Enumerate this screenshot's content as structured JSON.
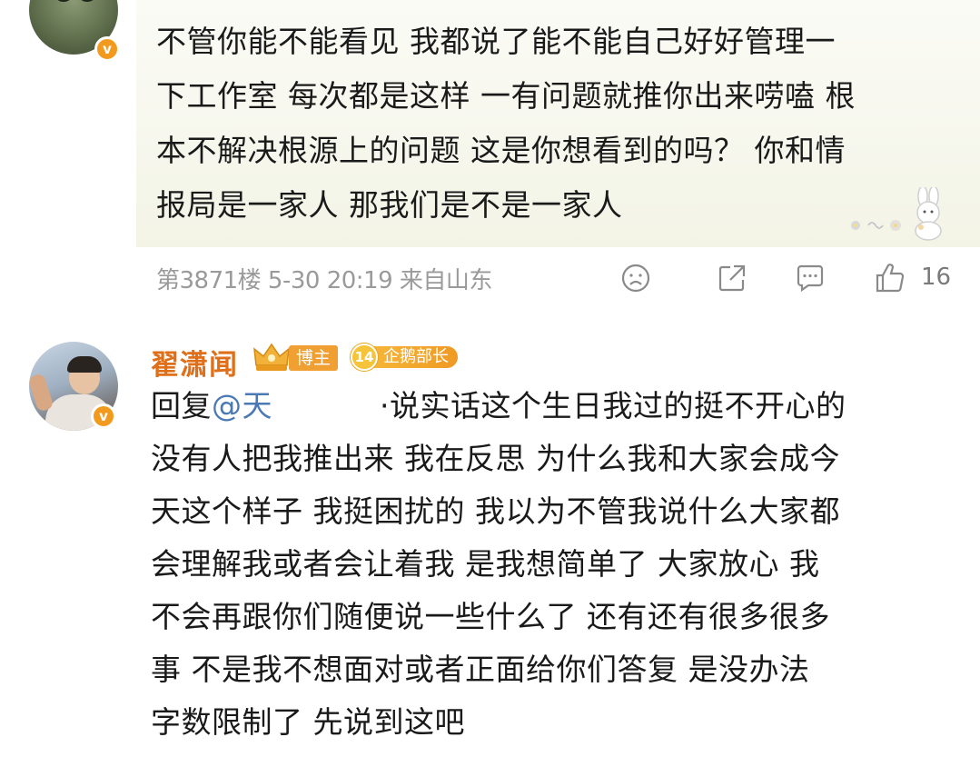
{
  "comment1": {
    "verified_mark": "v",
    "text_lines": [
      "不管你能不能看见 我都说了能不能自己好好管理一",
      "下工作室 每次都是这样 一有问题就推你出来唠嗑 根",
      "本不解决根源上的问题 这是你想看到的吗？ 你和情",
      "报局是一家人 那我们是不是一家人"
    ],
    "meta": "第3871楼 5-30 20:19 来自山东",
    "like_count": "16",
    "icons": [
      "frown-icon",
      "share-icon",
      "comment-icon",
      "thumbs-up-icon"
    ]
  },
  "comment2": {
    "username": "翟潇闻",
    "verified_mark": "v",
    "badge_blogger": "博主",
    "badge_level_number": "14",
    "badge_level_label": "企鹅部长",
    "reply_prefix": "回复",
    "mention": "@天",
    "mention_tail": "·",
    "text_first": "说实话这个生日我过的挺不开心的",
    "text_lines": [
      "没有人把我推出来 我在反思 为什么我和大家会成今",
      "天这个样子 我挺困扰的 我以为不管我说什么大家都",
      "会理解我或者会让着我 是我想简单了 大家放心 我",
      "不会再跟你们随便说一些什么了 还有还有很多很多",
      "事 不是我不想面对或者正面给你们答复 是没办法",
      "字数限制了 先说到这吧"
    ]
  },
  "colors": {
    "username": "#e06f1a",
    "mention": "#4a79b4",
    "meta": "#9a9a9a",
    "verified_badge": "#f29a1d"
  }
}
